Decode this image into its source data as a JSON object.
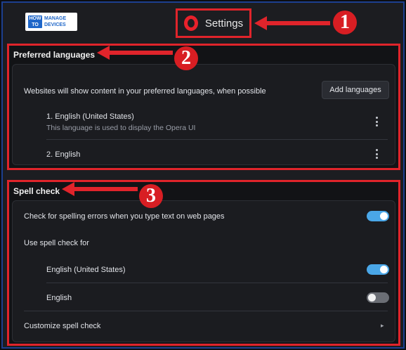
{
  "logo": {
    "line1": "HOW TO",
    "line2": "MANAGE",
    "line3": "DEVICES"
  },
  "header": {
    "title": "Settings",
    "badge": "1"
  },
  "languages": {
    "title": "Preferred languages",
    "badge": "2",
    "description": "Websites will show content in your preferred languages, when possible",
    "add_button": "Add languages",
    "items": [
      {
        "label": "1. English (United States)",
        "sub": "This language is used to display the Opera UI"
      },
      {
        "label": "2. English",
        "sub": ""
      }
    ]
  },
  "spell": {
    "title": "Spell check",
    "badge": "3",
    "check_label": "Check for spelling errors when you type text on web pages",
    "check_enabled": true,
    "use_for_label": "Use spell check for",
    "langs": [
      {
        "label": "English (United States)",
        "enabled": true
      },
      {
        "label": "English",
        "enabled": false
      }
    ],
    "customize_label": "Customize spell check"
  },
  "colors": {
    "accent_red": "#e0242b",
    "toggle_on": "#4aa7e8",
    "toggle_off": "#6b6e75"
  }
}
